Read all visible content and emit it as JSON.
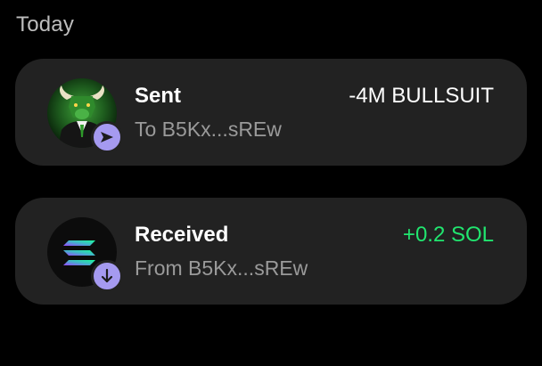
{
  "section": {
    "heading": "Today"
  },
  "colors": {
    "background": "#000000",
    "card": "#222222",
    "badge": "#a59af0",
    "positive_amount": "#21e56f",
    "negative_amount": "#ffffff",
    "secondary_text": "#9a9a9a"
  },
  "transactions": [
    {
      "title": "Sent",
      "counterparty": "To B5Kx...sREw",
      "amount": "-4M BULLSUIT",
      "direction": "sent",
      "token_icon": "bull-token-icon",
      "badge_icon": "send-arrow-icon"
    },
    {
      "title": "Received",
      "counterparty": "From B5Kx...sREw",
      "amount": "+0.2 SOL",
      "direction": "received",
      "token_icon": "solana-token-icon",
      "badge_icon": "arrow-down-icon"
    }
  ]
}
